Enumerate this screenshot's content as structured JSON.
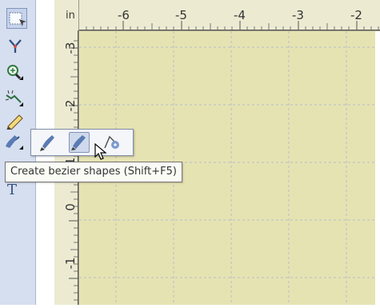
{
  "ruler": {
    "unit": "in",
    "horizontal_labels": [
      "-6",
      "-5",
      "-4",
      "-3",
      "-2"
    ],
    "vertical_labels": [
      "-3",
      "-2",
      "-1",
      "0",
      "-1"
    ]
  },
  "tooltip": {
    "text": "Create bezier shapes (Shift+F5)"
  },
  "toolbox": {
    "tools": [
      "pick-tool",
      "shape-tool",
      "zoom-tool",
      "freehand-tool",
      "smart-drawing-tool",
      "bezier-pen-tool",
      "rectangle-tool",
      "text-tool"
    ]
  },
  "flyout": {
    "items": [
      "freehand-icon",
      "bezier-icon",
      "polyline-icon"
    ],
    "active_item": "bezier-icon"
  },
  "colors": {
    "page": "#e6e3b3",
    "ruler": "#ecebd2",
    "toolbox": "#d6dff0",
    "guide": "#b7bcc7"
  }
}
